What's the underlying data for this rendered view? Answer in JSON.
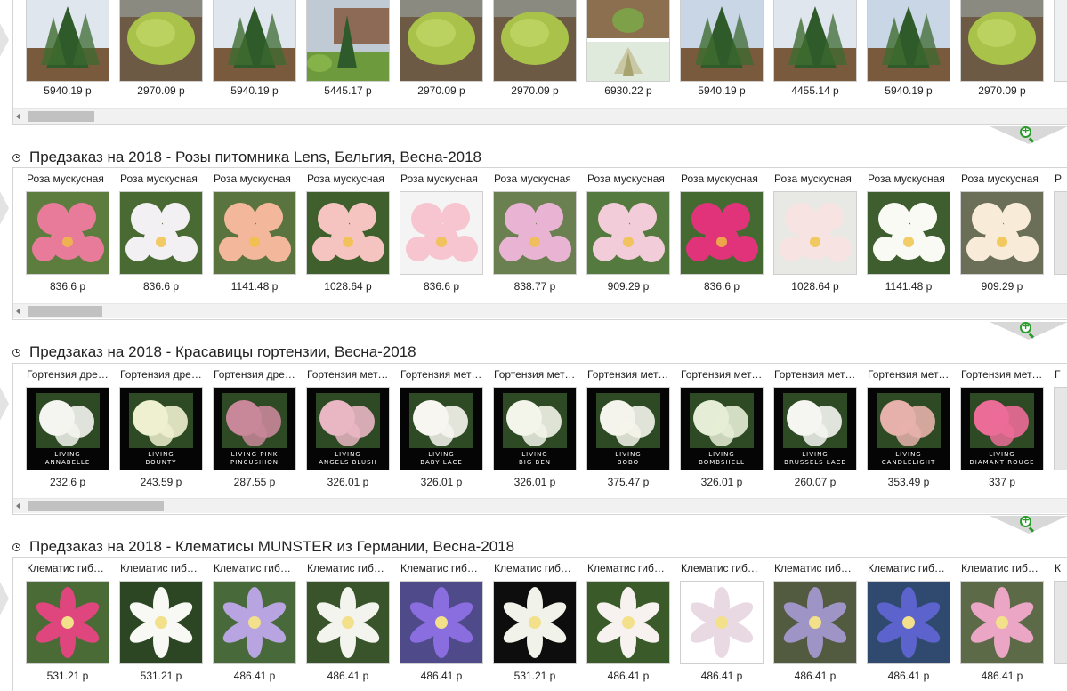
{
  "sections": [
    {
      "id": "conifers",
      "title": "",
      "items": [
        {
          "label": "",
          "price": "5940.19 р",
          "img": "conifer"
        },
        {
          "label": "",
          "price": "2970.09 р",
          "img": "shrub"
        },
        {
          "label": "",
          "price": "5940.19 р",
          "img": "conifer"
        },
        {
          "label": "",
          "price": "5445.17 р",
          "img": "garden"
        },
        {
          "label": "",
          "price": "2970.09 р",
          "img": "shrub"
        },
        {
          "label": "",
          "price": "2970.09 р",
          "img": "shrub"
        },
        {
          "label": "",
          "price": "6930.22 р",
          "img": "split"
        },
        {
          "label": "",
          "price": "5940.19 р",
          "img": "conifer"
        },
        {
          "label": "",
          "price": "4455.14 р",
          "img": "conifer"
        },
        {
          "label": "",
          "price": "5940.19 р",
          "img": "conifer"
        },
        {
          "label": "",
          "price": "2970.09 р",
          "img": "shrub"
        }
      ]
    },
    {
      "id": "roses",
      "title": "Предзаказ на 2018 - Розы питомника Lens, Бельгия, Весна-2018",
      "items": [
        {
          "label": "Роза мускусная",
          "price": "836.6 р",
          "color": "#e87a9a"
        },
        {
          "label": "Роза мускусная",
          "price": "836.6 р",
          "color": "#f2f0f3"
        },
        {
          "label": "Роза мускусная",
          "price": "1141.48 р",
          "color": "#f3b79b"
        },
        {
          "label": "Роза мускусная",
          "price": "1028.64 р",
          "color": "#f5c4c0"
        },
        {
          "label": "Роза мускусная",
          "price": "836.6 р",
          "color": "#f6c5cf"
        },
        {
          "label": "Роза мускусная",
          "price": "838.77 р",
          "color": "#e9b4d3"
        },
        {
          "label": "Роза мускусная",
          "price": "909.29 р",
          "color": "#f2ccd8"
        },
        {
          "label": "Роза мускусная",
          "price": "836.6 р",
          "color": "#e0337a"
        },
        {
          "label": "Роза мускусная",
          "price": "1028.64 р",
          "color": "#f7e4e2"
        },
        {
          "label": "Роза мускусная",
          "price": "1141.48 р",
          "color": "#fafaf5"
        },
        {
          "label": "Роза мускусная",
          "price": "909.29 р",
          "color": "#f8ecd9"
        }
      ],
      "more_label": "Р"
    },
    {
      "id": "hydrangeas",
      "title": "Предзаказ на 2018 - Красавицы гортензии, Весна-2018",
      "items": [
        {
          "label": "Гортензия древовидная",
          "price": "232.6 р",
          "color": "#f4f4f0",
          "l1": "LIVING",
          "l2": "ANNABELLE"
        },
        {
          "label": "Гортензия древовидная",
          "price": "243.59 р",
          "color": "#eef0cf",
          "l1": "LIVING",
          "l2": "BOUNTY"
        },
        {
          "label": "Гортензия древовидная",
          "price": "287.55 р",
          "color": "#c9879a",
          "l1": "LIVING PINK",
          "l2": "PINCUSHION"
        },
        {
          "label": "Гортензия метельчатая",
          "price": "326.01 р",
          "color": "#e9b6c3",
          "l1": "LIVING",
          "l2": "ANGELS BLUSH"
        },
        {
          "label": "Гортензия метельчатая",
          "price": "326.01 р",
          "color": "#f7f6f0",
          "l1": "LIVING",
          "l2": "BABY LACE"
        },
        {
          "label": "Гортензия метельчатая",
          "price": "326.01 р",
          "color": "#f3f4ea",
          "l1": "LIVING",
          "l2": "BIG BEN"
        },
        {
          "label": "Гортензия метельчатая",
          "price": "375.47 р",
          "color": "#f4f4ec",
          "l1": "LIVING",
          "l2": "BOBO"
        },
        {
          "label": "Гортензия метельчатая",
          "price": "326.01 р",
          "color": "#e6edd6",
          "l1": "LIVING",
          "l2": "BOMBSHELL"
        },
        {
          "label": "Гортензия метельчатая",
          "price": "260.07 р",
          "color": "#f5f5f2",
          "l1": "LIVING",
          "l2": "BRUSSELS LACE"
        },
        {
          "label": "Гортензия метельчатая",
          "price": "353.49 р",
          "color": "#e7b1ab",
          "l1": "LIVING",
          "l2": "CANDLELIGHT"
        },
        {
          "label": "Гортензия метельчатая",
          "price": "337 р",
          "color": "#ec6c98",
          "l1": "LIVING",
          "l2": "DIAMANT ROUGE"
        }
      ],
      "more_label": "Г"
    },
    {
      "id": "clematis",
      "title": "Предзаказ на 2018 - Клематисы MUNSTER из Германии, Весна-2018",
      "items": [
        {
          "label": "Клематис гибридный",
          "price": "531.21 р",
          "color": "#e0467e"
        },
        {
          "label": "Клематис гибридный",
          "price": "531.21 р",
          "color": "#f8f8f4"
        },
        {
          "label": "Клематис гибридный",
          "price": "486.41 р",
          "color": "#b8a4e0"
        },
        {
          "label": "Клематис гибридный",
          "price": "486.41 р",
          "color": "#f4f4ee"
        },
        {
          "label": "Клематис гибридный",
          "price": "486.41 р",
          "color": "#8a6ee0"
        },
        {
          "label": "Клематис гибридный",
          "price": "531.21 р",
          "color": "#f1f2ea"
        },
        {
          "label": "Клематис гибридный",
          "price": "486.41 р",
          "color": "#f7f2ef"
        },
        {
          "label": "Клематис гибридный",
          "price": "486.41 р",
          "color": "#e8d9e3"
        },
        {
          "label": "Клематис гибридный",
          "price": "486.41 р",
          "color": "#9e95c6"
        },
        {
          "label": "Клематис гибридный",
          "price": "486.41 р",
          "color": "#5d63cc"
        },
        {
          "label": "Клематис гибридный",
          "price": "486.41 р",
          "color": "#eaa6c4"
        }
      ],
      "more_label": "К"
    }
  ],
  "colors": {
    "accent_green": "#2a9b2a",
    "border": "#d4d4d4",
    "scroll_track": "#f1f1f1",
    "scroll_thumb": "#c1c1c1"
  },
  "icons": {
    "section_icon": "clock-icon",
    "zoom_icon": "zoom-in-icon",
    "scroll_arrow": "arrow-left-icon"
  }
}
